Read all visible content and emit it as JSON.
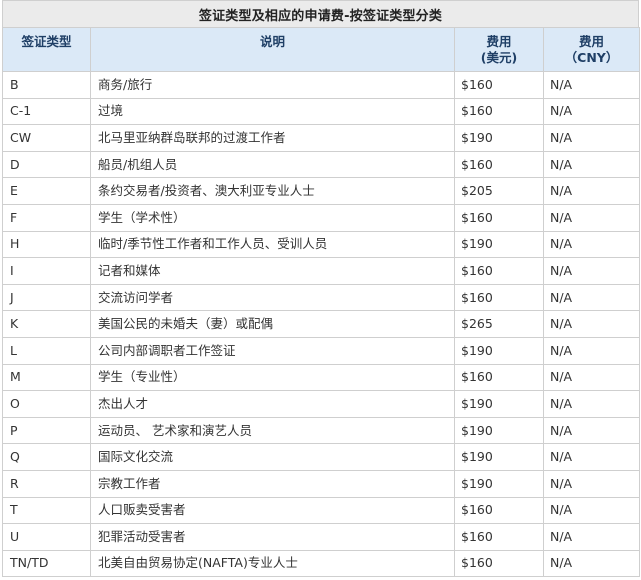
{
  "table": {
    "caption": "签证类型及相应的申请费-按签证类型分类",
    "headers": {
      "type": "签证类型",
      "desc": "说明",
      "usd_line1": "费用",
      "usd_line2": "(美元)",
      "cny_line1": "费用",
      "cny_line2": "（CNY）"
    },
    "rows": [
      {
        "type": "B",
        "desc": "商务/旅行",
        "usd": "$160",
        "cny": "N/A"
      },
      {
        "type": "C-1",
        "desc": "过境",
        "usd": "$160",
        "cny": "N/A"
      },
      {
        "type": "CW",
        "desc": "北马里亚纳群岛联邦的过渡工作者",
        "usd": "$190",
        "cny": "N/A"
      },
      {
        "type": "D",
        "desc": "船员/机组人员",
        "usd": "$160",
        "cny": "N/A"
      },
      {
        "type": "E",
        "desc": "条约交易者/投资者、澳大利亚专业人士",
        "usd": "$205",
        "cny": "N/A"
      },
      {
        "type": "F",
        "desc": "学生（学术性）",
        "usd": "$160",
        "cny": "N/A"
      },
      {
        "type": "H",
        "desc": "临时/季节性工作者和工作人员、受训人员",
        "usd": "$190",
        "cny": "N/A"
      },
      {
        "type": "I",
        "desc": "记者和媒体",
        "usd": "$160",
        "cny": "N/A"
      },
      {
        "type": "J",
        "desc": "交流访问学者",
        "usd": "$160",
        "cny": "N/A"
      },
      {
        "type": "K",
        "desc": "美国公民的未婚夫（妻）或配偶",
        "usd": "$265",
        "cny": "N/A"
      },
      {
        "type": "L",
        "desc": "公司内部调职者工作签证",
        "usd": "$190",
        "cny": "N/A"
      },
      {
        "type": "M",
        "desc": "学生（专业性）",
        "usd": "$160",
        "cny": "N/A"
      },
      {
        "type": "O",
        "desc": "杰出人才",
        "usd": "$190",
        "cny": "N/A"
      },
      {
        "type": "P",
        "desc": "运动员、 艺术家和演艺人员",
        "usd": "$190",
        "cny": "N/A"
      },
      {
        "type": "Q",
        "desc": "国际文化交流",
        "usd": "$190",
        "cny": "N/A"
      },
      {
        "type": "R",
        "desc": "宗教工作者",
        "usd": "$190",
        "cny": "N/A"
      },
      {
        "type": "T",
        "desc": "人口贩卖受害者",
        "usd": "$160",
        "cny": "N/A"
      },
      {
        "type": "U",
        "desc": "犯罪活动受害者",
        "usd": "$160",
        "cny": "N/A"
      },
      {
        "type": "TN/TD",
        "desc": "北美自由贸易协定(NAFTA)专业人士",
        "usd": "$160",
        "cny": "N/A"
      }
    ]
  },
  "colors": {
    "caption_bg": "#ebebeb",
    "header_bg": "#dbe9f7",
    "header_text": "#1f3f66",
    "border": "#cfcfcf",
    "body_text": "#333333"
  }
}
